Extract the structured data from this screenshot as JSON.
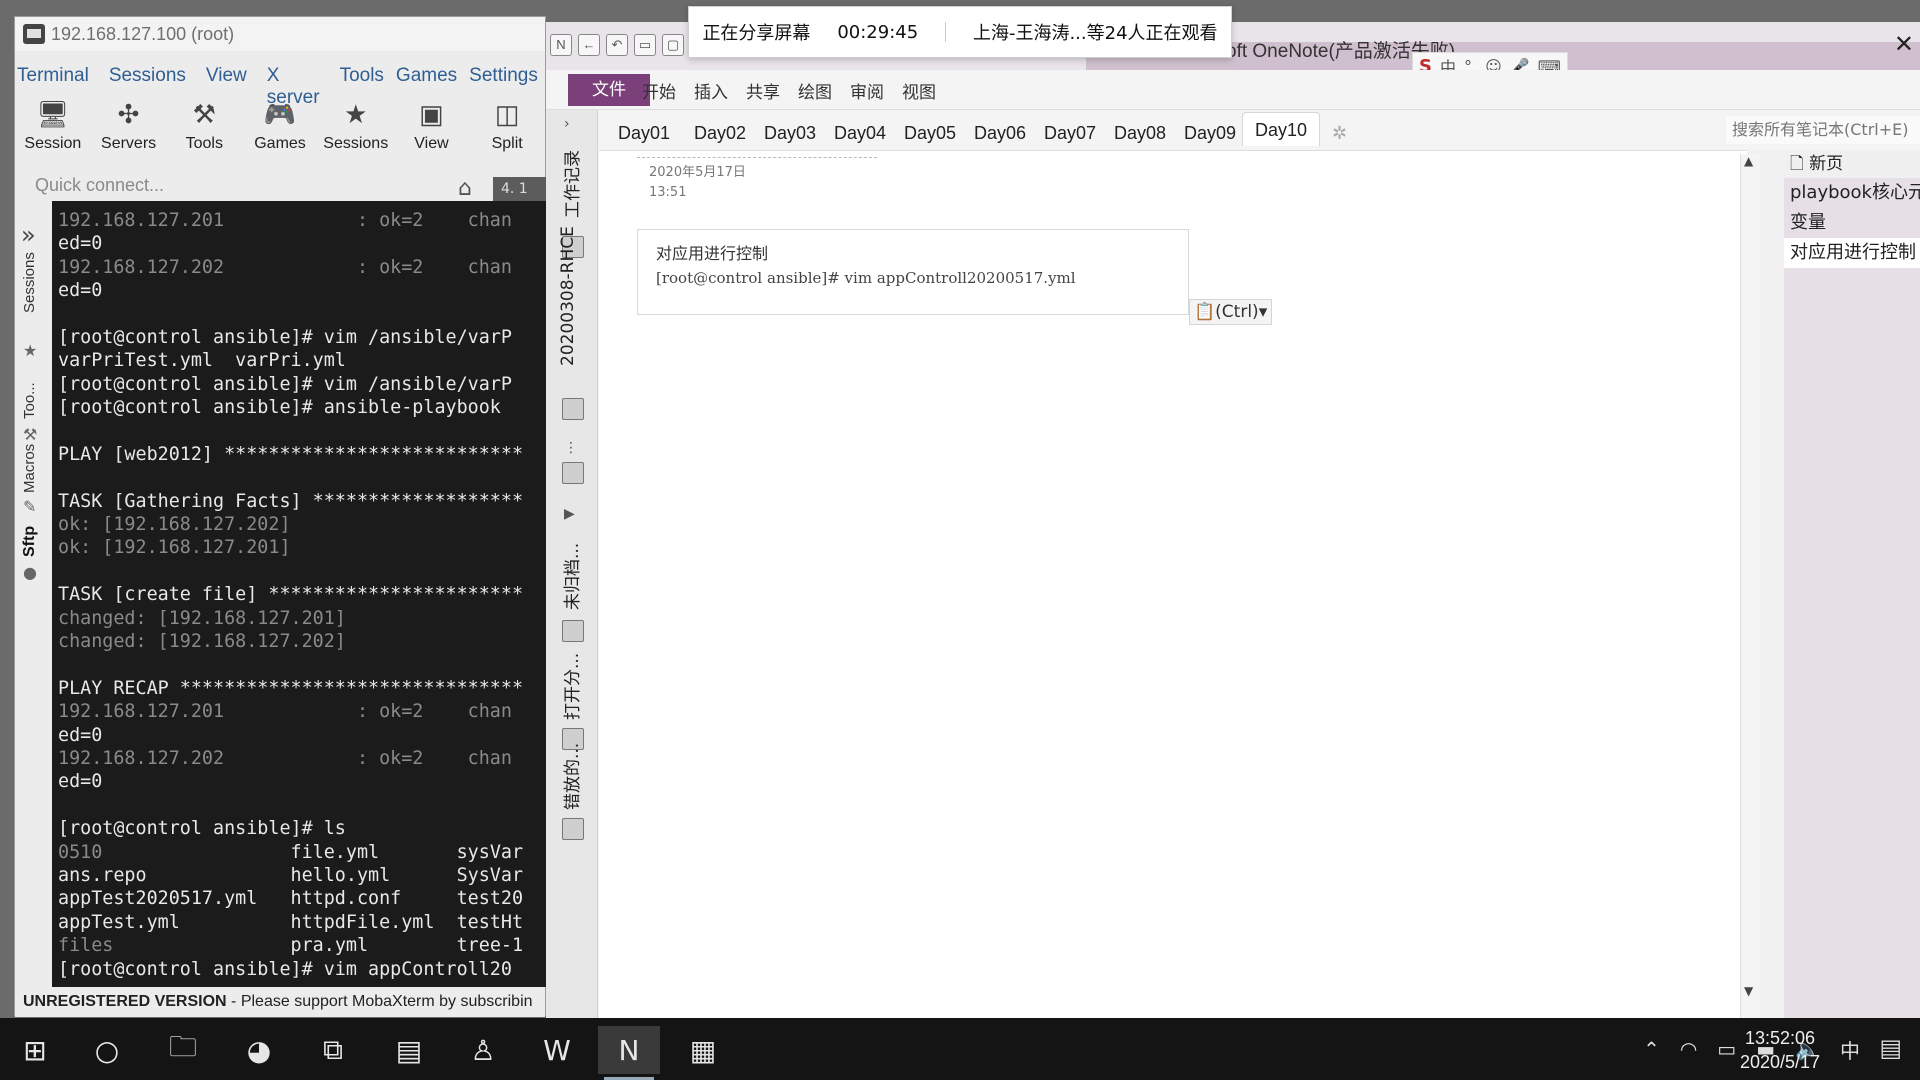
{
  "mobaxterm": {
    "title": "192.168.127.100 (root)",
    "menu": [
      "Terminal",
      "Sessions",
      "View",
      "X server",
      "Tools",
      "Games",
      "Settings"
    ],
    "toolbar": [
      "Session",
      "Servers",
      "Tools",
      "Games",
      "Sessions",
      "View",
      "Split"
    ],
    "quick_connect": "Quick connect...",
    "tab_stub": "4. 1",
    "side_labels": [
      "Sessions",
      "Too...",
      "Macros",
      "Sftp"
    ],
    "status_unregistered": "UNREGISTERED VERSION",
    "status_message": "-  Please support MobaXterm by subscribin"
  },
  "terminal": {
    "lines": [
      {
        "text": "192.168.127.201            : ok=2    chan",
        "style": "dim"
      },
      {
        "text": "ed=0",
        "style": ""
      },
      {
        "text": "192.168.127.202            : ok=2    chan",
        "style": "dim"
      },
      {
        "text": "ed=0",
        "style": ""
      },
      {
        "text": "",
        "style": ""
      },
      {
        "text": "[root@control ansible]# vim /ansible/varP",
        "style": ""
      },
      {
        "text": "varPriTest.yml  varPri.yml",
        "style": ""
      },
      {
        "text": "[root@control ansible]# vim /ansible/varP",
        "style": ""
      },
      {
        "text": "[root@control ansible]# ansible-playbook",
        "style": ""
      },
      {
        "text": "",
        "style": ""
      },
      {
        "text": "PLAY [web2012] ***************************",
        "style": ""
      },
      {
        "text": "",
        "style": ""
      },
      {
        "text": "TASK [Gathering Facts] *******************",
        "style": ""
      },
      {
        "text": "ok: [192.168.127.202]",
        "style": "dim"
      },
      {
        "text": "ok: [192.168.127.201]",
        "style": "dim"
      },
      {
        "text": "",
        "style": ""
      },
      {
        "text": "TASK [create file] ***********************",
        "style": ""
      },
      {
        "text": "changed: [192.168.127.201]",
        "style": "dim"
      },
      {
        "text": "changed: [192.168.127.202]",
        "style": "dim"
      },
      {
        "text": "",
        "style": ""
      },
      {
        "text": "PLAY RECAP *******************************",
        "style": ""
      },
      {
        "text": "192.168.127.201            : ok=2    chan",
        "style": "dim"
      },
      {
        "text": "ed=0",
        "style": ""
      },
      {
        "text": "192.168.127.202            : ok=2    chan",
        "style": "dim"
      },
      {
        "text": "ed=0",
        "style": ""
      },
      {
        "text": "",
        "style": ""
      },
      {
        "text": "[root@control ansible]# ls",
        "style": ""
      },
      {
        "text": "0510                 file.yml       sysVar",
        "style": "mixed1"
      },
      {
        "text": "ans.repo             hello.yml      SysVar",
        "style": ""
      },
      {
        "text": "appTest2020517.yml   httpd.conf     test20",
        "style": ""
      },
      {
        "text": "appTest.yml          httpdFile.yml  testHt",
        "style": ""
      },
      {
        "text": "files                pra.yml        tree-1",
        "style": "mixed2"
      },
      {
        "text": "[root@control ansible]# vim appControll20",
        "style": ""
      }
    ]
  },
  "share_banner": {
    "status": "正在分享屏幕",
    "timer": "00:29:45",
    "viewers": "上海-王海涛...等24人正在观看"
  },
  "onenote": {
    "window_title": "oft OneNote(产品激活失败)",
    "ribbon_file": "文件",
    "ribbon_tabs": [
      "开始",
      "插入",
      "共享",
      "绘图",
      "审阅",
      "视图"
    ],
    "ime": [
      "中",
      "°,",
      "☺",
      "🎤",
      "⌨"
    ],
    "notebook_labels": [
      "工作记录",
      "20200308-RHCE",
      "未归档...",
      "打开分...",
      "错放的..."
    ],
    "sections": [
      "Day01",
      "Day02",
      "Day03",
      "Day04",
      "Day05",
      "Day06",
      "Day07",
      "Day08",
      "Day09",
      "Day10"
    ],
    "active_section": "Day10",
    "search_placeholder": "搜索所有笔记本(Ctrl+E)",
    "page_date": "2020年5月17日",
    "page_time": "13:51",
    "note_title": "对应用进行控制",
    "note_command": "[root@control ansible]# vim appControll20200517.yml",
    "paste_label": "(Ctrl)",
    "new_page": "新页",
    "pages": [
      "playbook核心元",
      "变量",
      "对应用进行控制"
    ],
    "selected_page": "对应用进行控制"
  },
  "taskbar": {
    "clock_time": "13:52:06",
    "clock_date": "2020/5/17",
    "ime_indicator": "中"
  }
}
